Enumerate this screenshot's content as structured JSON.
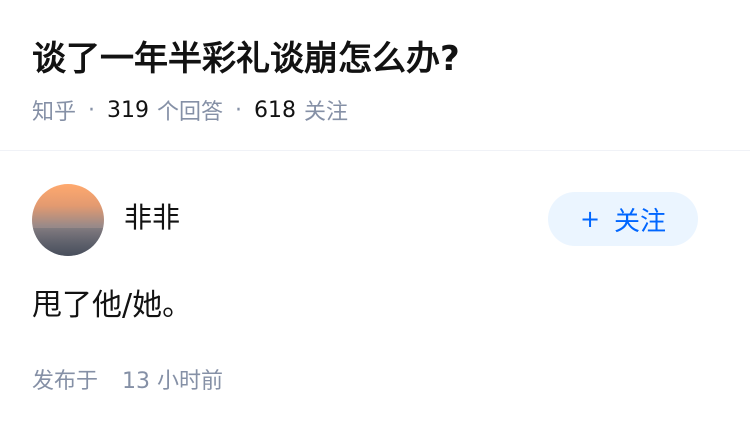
{
  "question": {
    "title": "谈了一年半彩礼谈崩怎么办?",
    "source": "知乎",
    "separator": "·",
    "answer_count": "319",
    "answer_count_label": "个回答",
    "follower_count": "618",
    "follower_label": "关注"
  },
  "answer": {
    "author_name": "非非",
    "follow_icon": "plus-icon",
    "follow_symbol": "+",
    "follow_label": "关注",
    "content": "甩了他/她。",
    "published_label": "发布于",
    "published_time": "13 小时前"
  },
  "colors": {
    "text_primary": "#121212",
    "text_secondary": "#8590a6",
    "accent": "#0066ff",
    "button_bg": "#ebf5ff"
  }
}
